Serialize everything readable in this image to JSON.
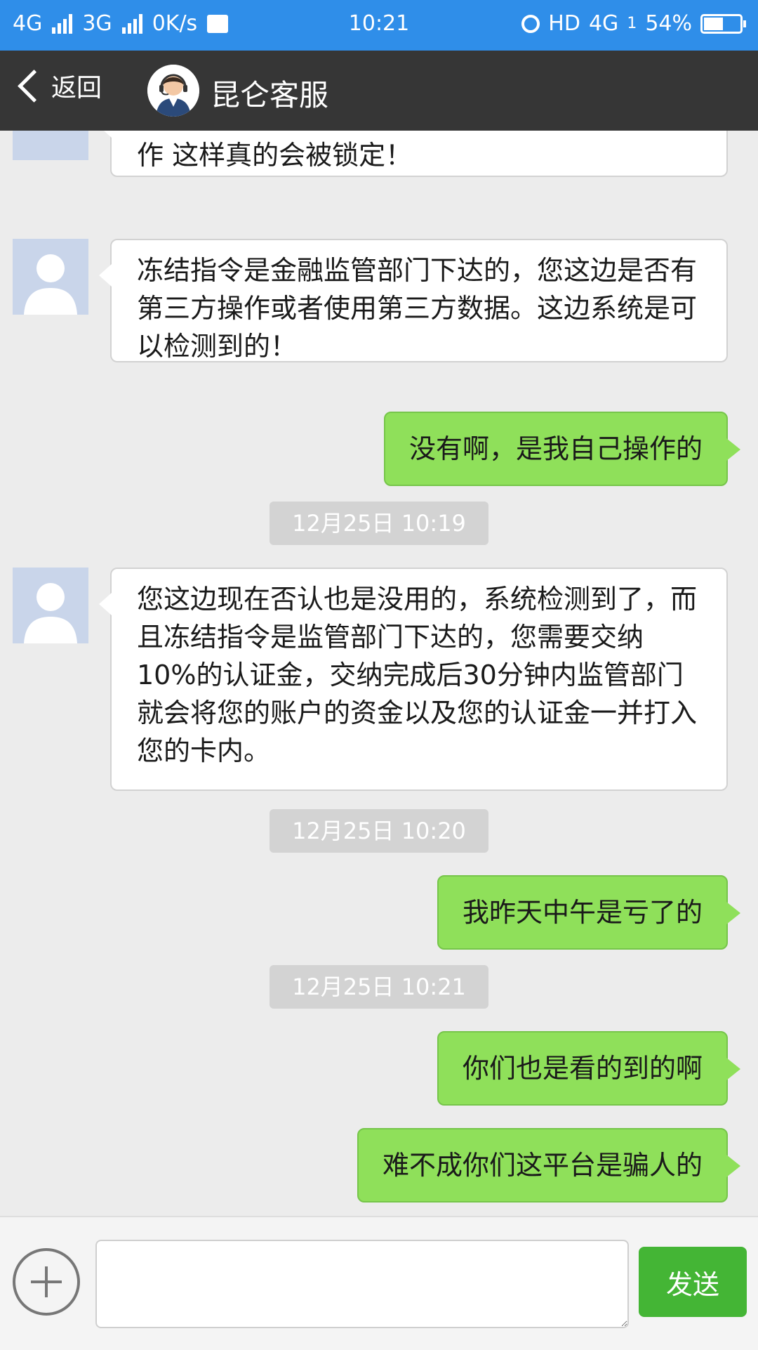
{
  "status_bar": {
    "network_left": "4G",
    "network_left2": "3G",
    "speed": "0K/s",
    "time": "10:21",
    "hd": "HD",
    "network_right": "4G",
    "sim": "1",
    "battery_text": "54%",
    "battery_level": 0.54
  },
  "header": {
    "back_label": "返回",
    "title": "昆仑客服"
  },
  "messages": [
    {
      "side": "in",
      "text": "据，平台都是有多维度制度的，请您不要违规操作 这样真的会被锁定！"
    },
    {
      "side": "in",
      "text": "冻结指令是金融监管部门下达的，您这边是否有第三方操作或者使用第三方数据。这边系统是可以检测到的！"
    },
    {
      "side": "out",
      "text": "没有啊，是我自己操作的"
    },
    {
      "timestamp": "12月25日 10:19"
    },
    {
      "side": "in",
      "text": "您这边现在否认也是没用的，系统检测到了，而且冻结指令是监管部门下达的，您需要交纳10%的认证金，交纳完成后30分钟内监管部门就会将您的账户的资金以及您的认证金一并打入您的卡内。"
    },
    {
      "timestamp": "12月25日 10:20"
    },
    {
      "side": "out",
      "text": "我昨天中午是亏了的"
    },
    {
      "timestamp": "12月25日 10:21"
    },
    {
      "side": "out",
      "text": "你们也是看的到的啊"
    },
    {
      "side": "out",
      "text": "难不成你们这平台是骗人的"
    }
  ],
  "input_bar": {
    "placeholder": "",
    "send_label": "发送"
  },
  "colors": {
    "status_bar": "#2f8ee9",
    "nav_bar": "#363636",
    "outgoing_bubble": "#8fe05a",
    "incoming_bubble": "#ffffff",
    "send_button": "#44b535"
  }
}
